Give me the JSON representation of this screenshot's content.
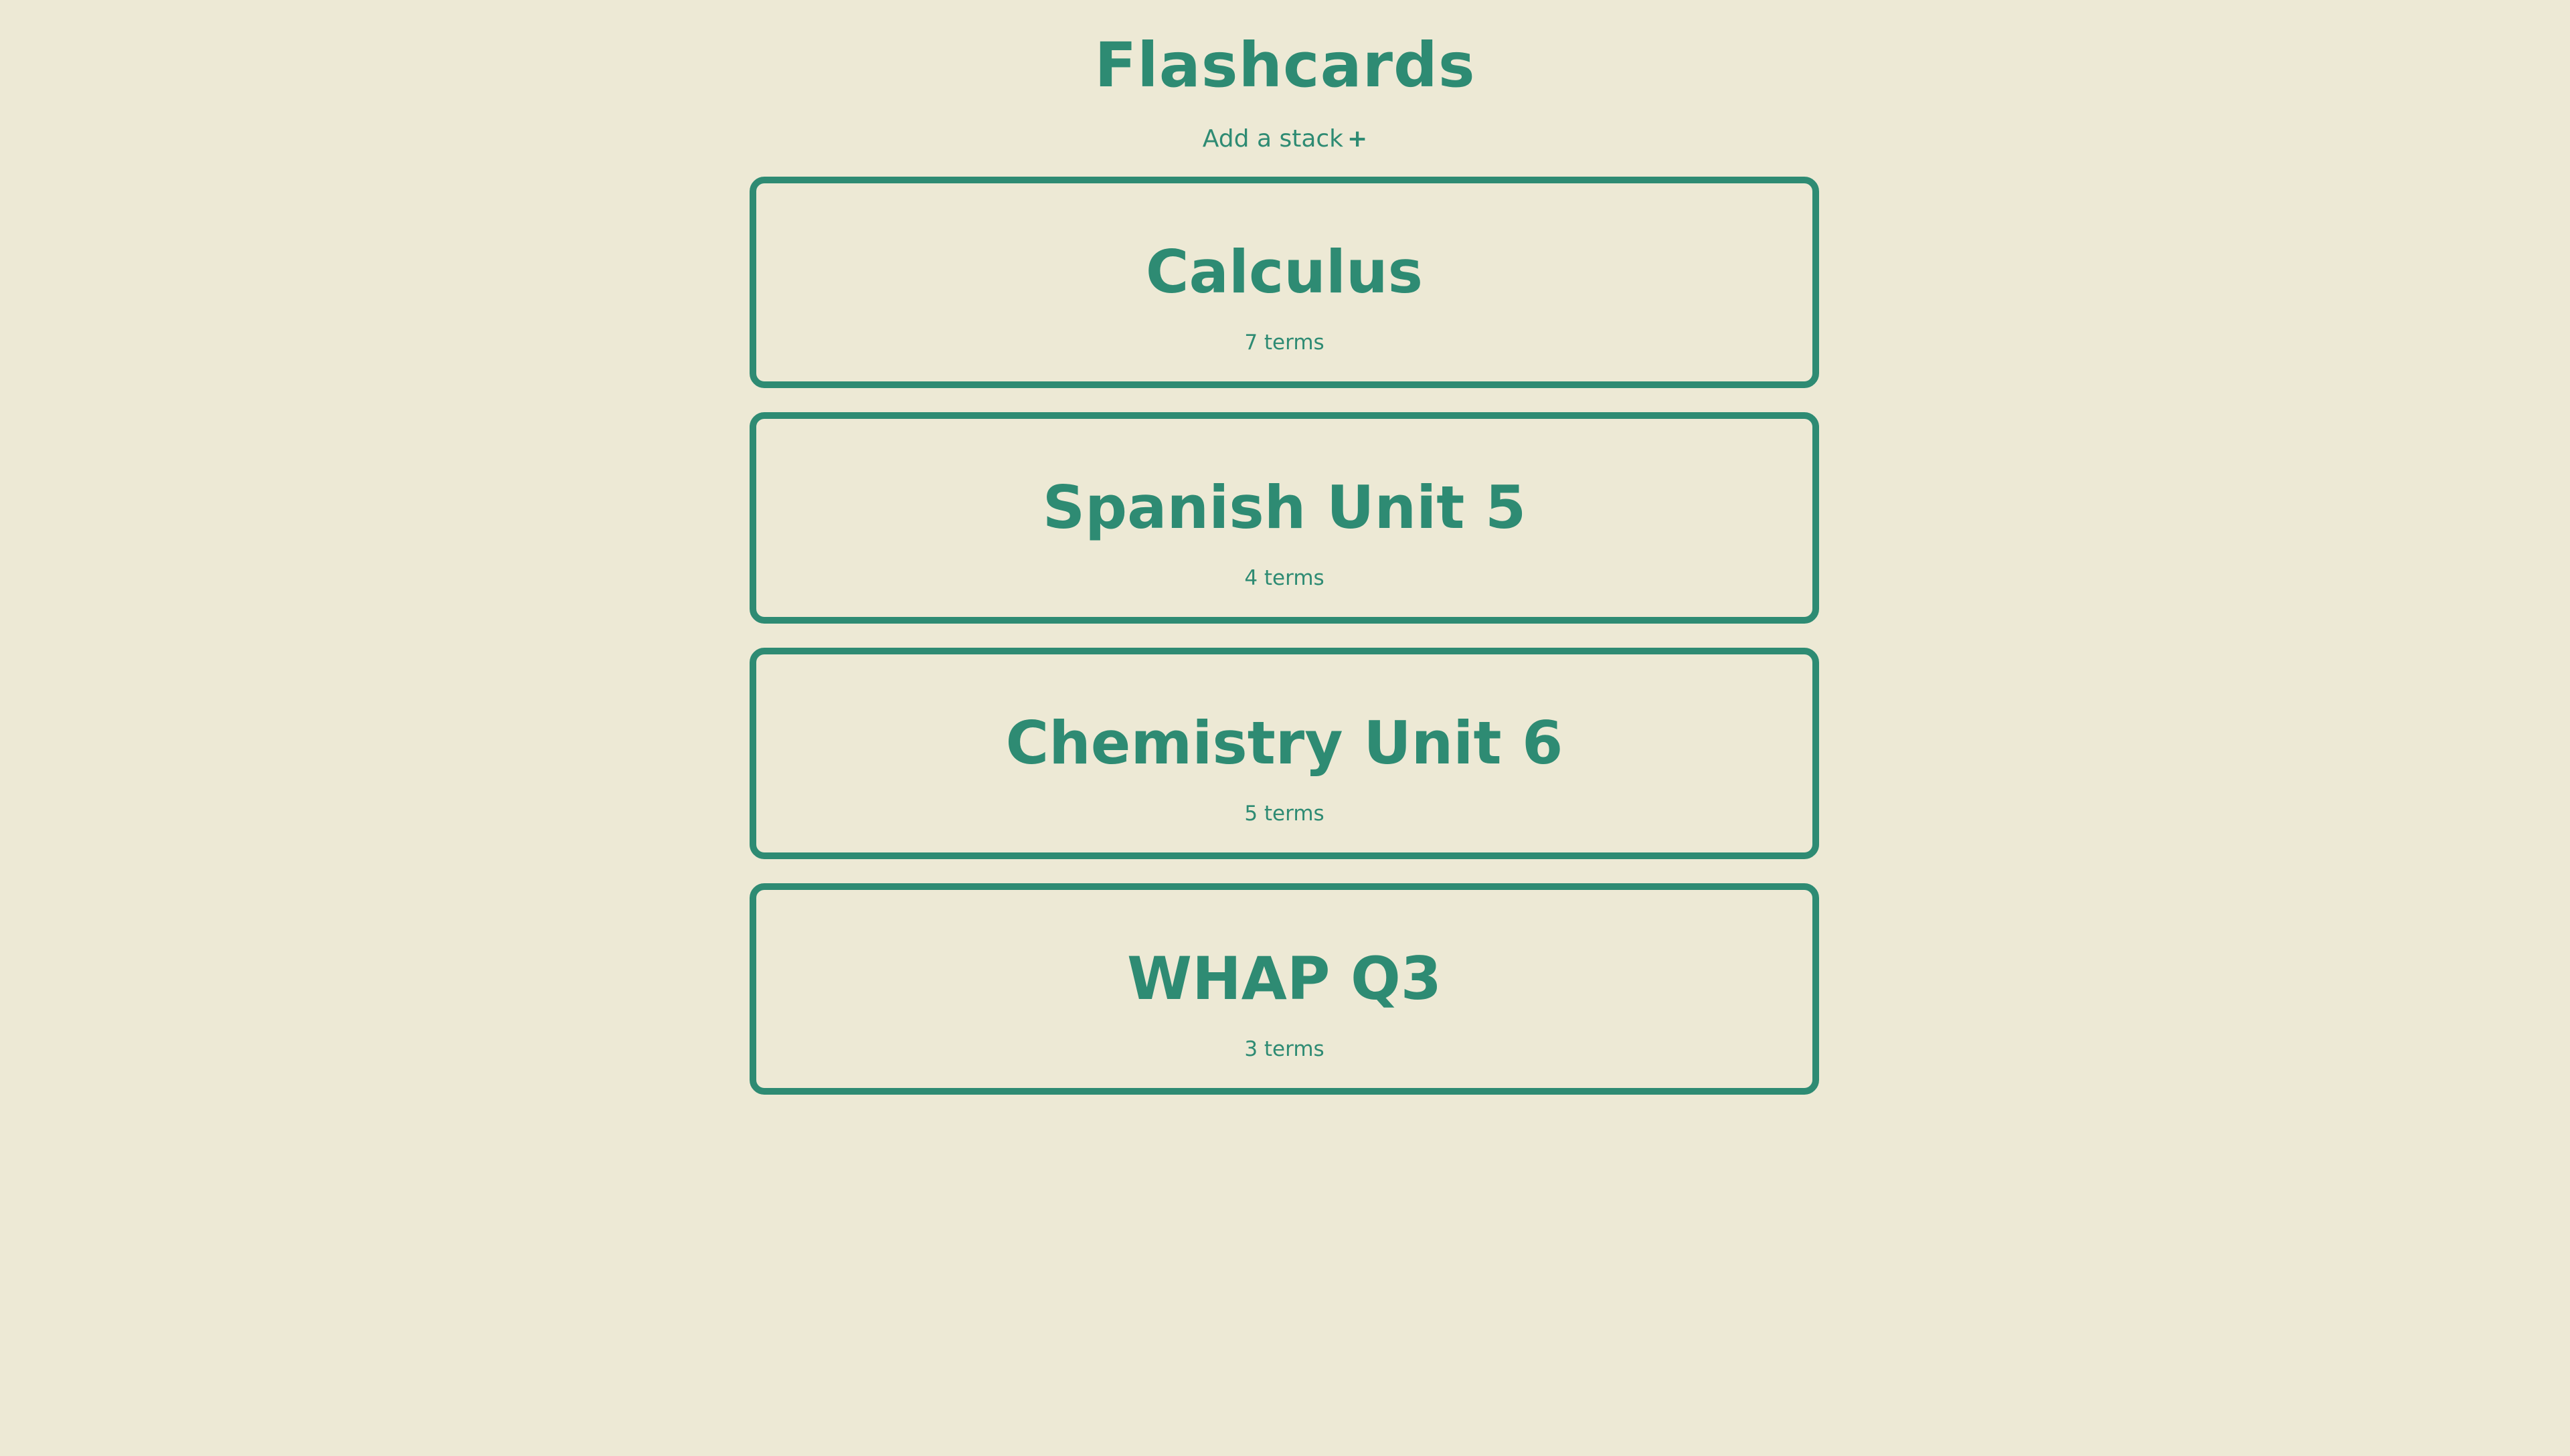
{
  "header": {
    "title": "Flashcards",
    "add_stack_label": "Add a stack",
    "add_stack_icon": "+"
  },
  "stacks": [
    {
      "name": "Calculus",
      "count": "7 terms"
    },
    {
      "name": "Spanish Unit 5",
      "count": "4 terms"
    },
    {
      "name": "Chemistry Unit 6",
      "count": "5 terms"
    },
    {
      "name": "WHAP Q3",
      "count": "3 terms"
    }
  ],
  "colors": {
    "background": "#ede9d5",
    "accent": "#2e8b73"
  }
}
